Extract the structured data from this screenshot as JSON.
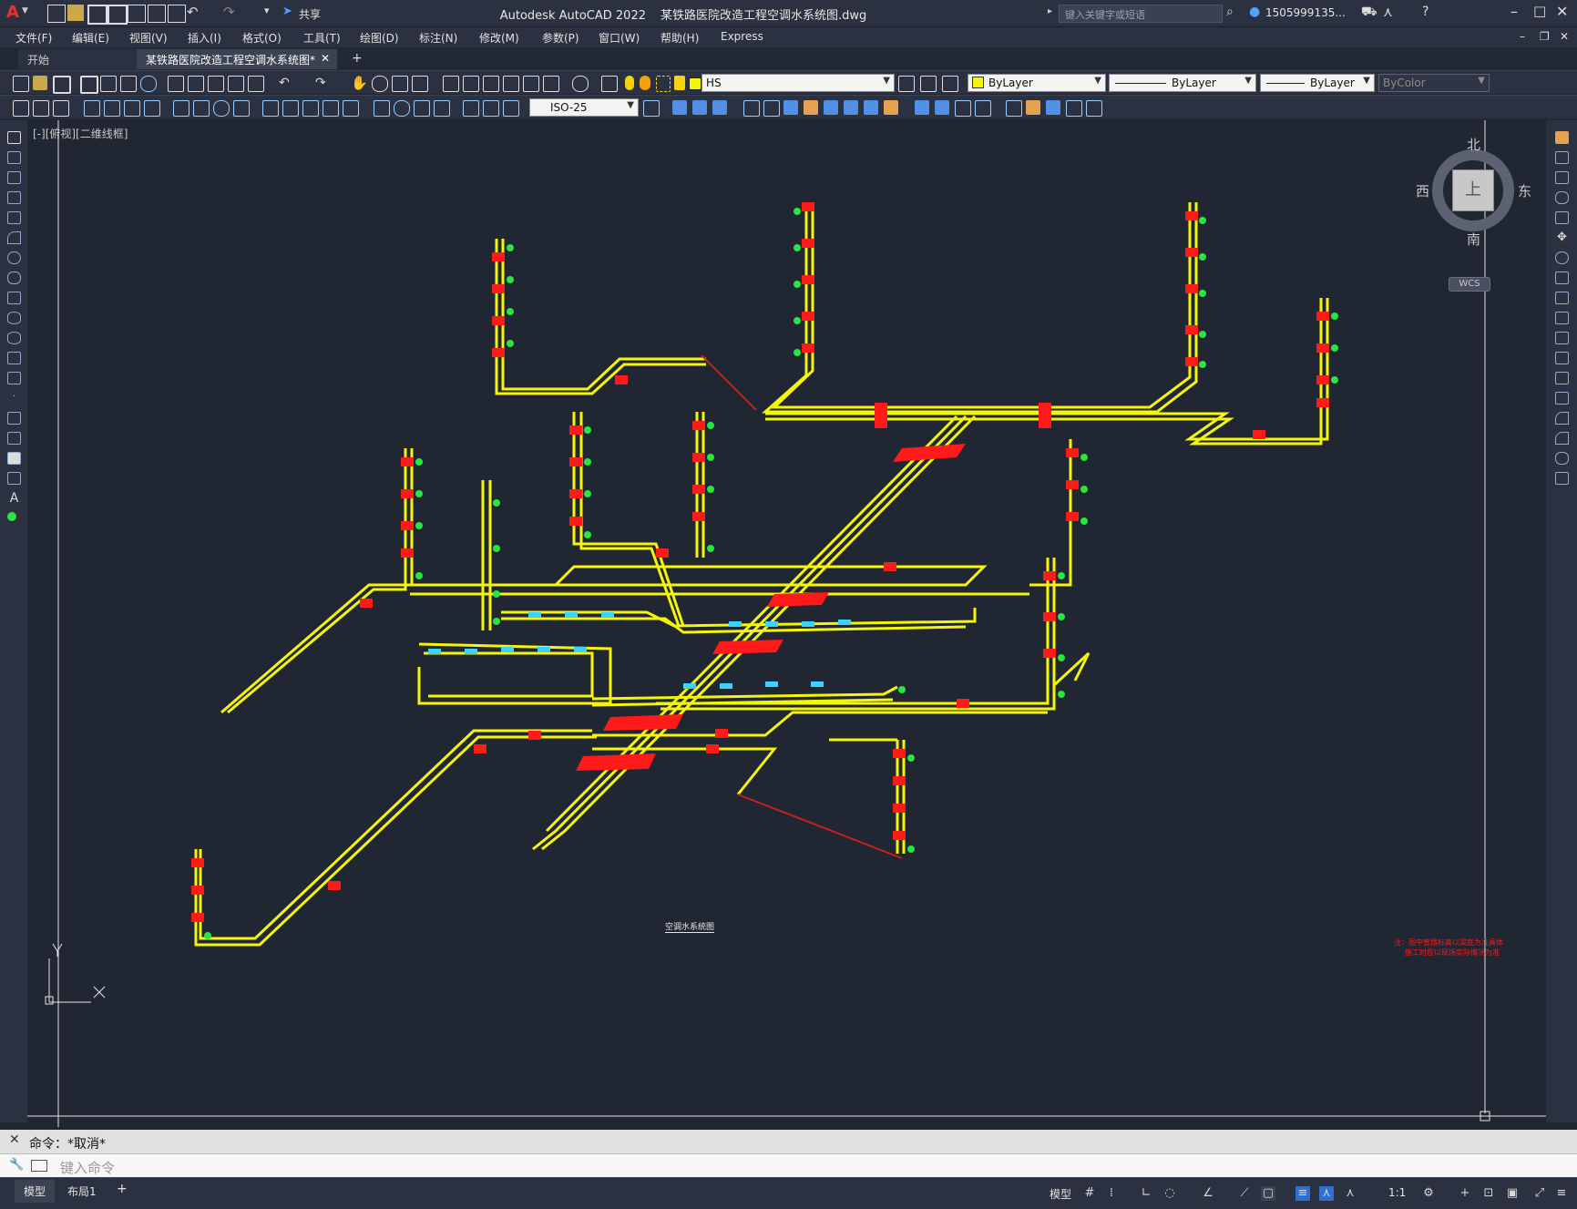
{
  "titlebar": {
    "app_title": "Autodesk AutoCAD 2022",
    "file_title": "某铁路医院改造工程空调水系统图.dwg",
    "share_label": "共享",
    "search_placeholder": "键入关键字或短语",
    "user_label": "1505999135...",
    "app_logo": "A"
  },
  "menubar": {
    "items": [
      "文件(F)",
      "编辑(E)",
      "视图(V)",
      "插入(I)",
      "格式(O)",
      "工具(T)",
      "绘图(D)",
      "标注(N)",
      "修改(M)",
      "参数(P)",
      "窗口(W)",
      "帮助(H)",
      "Express"
    ]
  },
  "tabs": {
    "start": "开始",
    "active": "某铁路医院改造工程空调水系统图*"
  },
  "toolbars": {
    "layer_name": "HS",
    "color_value": "ByLayer",
    "linetype_value": "ByLayer",
    "lineweight_value": "ByLayer",
    "plotstyle_value": "ByColor",
    "dimstyle_value": "ISO-25"
  },
  "viewport": {
    "view_label": "[-][俯视][二维线框]",
    "compass": {
      "north": "北",
      "south": "南",
      "east": "东",
      "west": "西",
      "top": "上",
      "wcs": "WCS"
    },
    "drawing_title": "空调水系统图",
    "note_line1": "注：图中管路标高以梁底为准具体",
    "note_line2": "施工时应以现场实际情况为准"
  },
  "command": {
    "history": "命令：*取消*",
    "placeholder": "键入命令"
  },
  "statusbar": {
    "model_tab": "模型",
    "layout_tab": "布局1",
    "model_button": "模型",
    "scale": "1:1"
  },
  "colors": {
    "pipe": "#f5f50a",
    "valve": "#ff1a1a",
    "fitting": "#27e641",
    "unit": "#3ad2ff",
    "background": "#212633"
  }
}
